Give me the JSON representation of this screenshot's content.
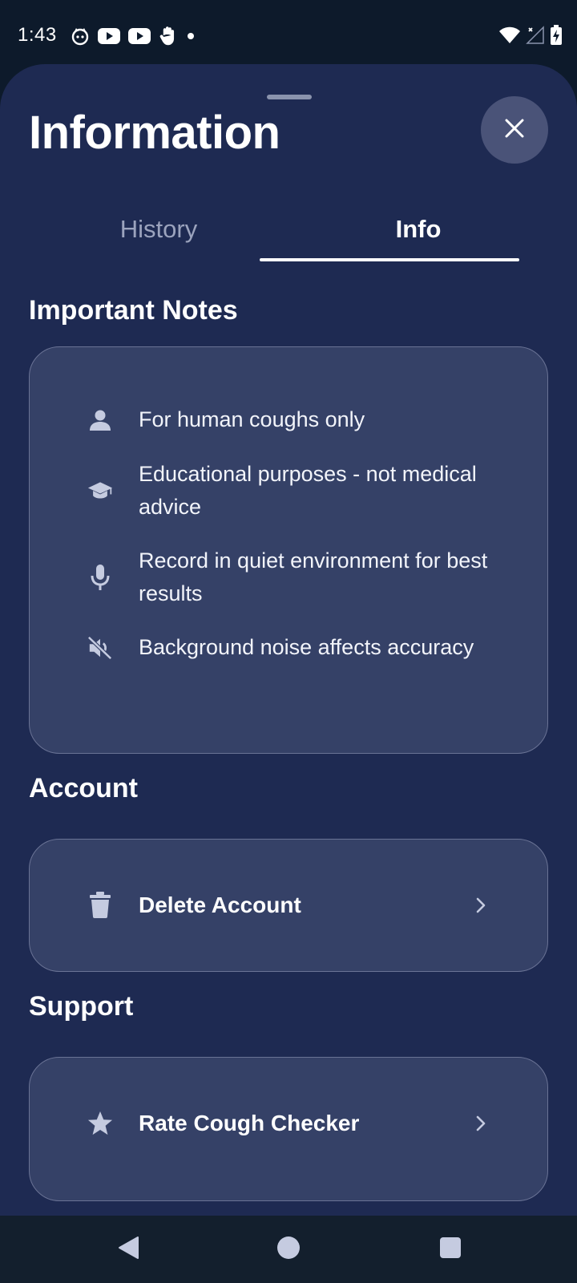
{
  "status_bar": {
    "time": "1:43",
    "left_icons": [
      "cat-face-icon",
      "youtube-icon",
      "youtube-icon",
      "hand-icon",
      "dot-icon"
    ],
    "right_icons": [
      "wifi-icon",
      "cellular-no-signal-icon",
      "battery-charging-icon"
    ]
  },
  "header": {
    "title": "Information",
    "close_icon": "close-icon"
  },
  "tabs": [
    {
      "label": "History",
      "selected": false
    },
    {
      "label": "Info",
      "selected": true
    }
  ],
  "sections": {
    "important_notes": {
      "title": "Important Notes",
      "items": [
        {
          "icon": "person-icon",
          "text": "For human coughs only"
        },
        {
          "icon": "graduation-cap-icon",
          "text": "Educational purposes - not medical advice"
        },
        {
          "icon": "microphone-icon",
          "text": "Record in quiet environment for best results"
        },
        {
          "icon": "volume-off-icon",
          "text": "Background noise affects accuracy"
        }
      ]
    },
    "account": {
      "title": "Account",
      "items": [
        {
          "icon": "trash-icon",
          "label": "Delete Account"
        }
      ]
    },
    "support": {
      "title": "Support",
      "items": [
        {
          "icon": "star-icon",
          "label": "Rate Cough Checker"
        }
      ]
    }
  },
  "nav_bar": {
    "buttons": [
      "back-icon",
      "home-icon",
      "recents-icon"
    ]
  },
  "colors": {
    "status_bar_bg": "#0d1a2b",
    "sheet_bg": "#1e2a52",
    "card_bg": "#354167",
    "card_border": "#6a7395",
    "close_button_bg": "#4a5378",
    "muted_text": "#9ba3bd",
    "icon_color": "#c5cbe0"
  }
}
